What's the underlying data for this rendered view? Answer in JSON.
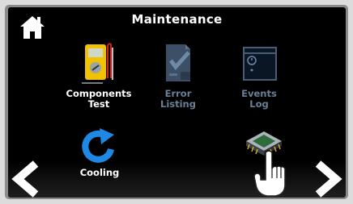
{
  "header": {
    "title": "Maintenance"
  },
  "tiles": [
    {
      "line1": "Components",
      "line2": "Test"
    },
    {
      "line1": "Error",
      "line2": "Listing"
    },
    {
      "line1": "Events",
      "line2": "Log"
    },
    {
      "line1": "Cooling"
    }
  ],
  "icons": {
    "home": "home-icon",
    "components": "multimeter-icon",
    "error": "error-listing-icon",
    "events": "events-log-icon",
    "cooling": "refresh-icon",
    "chip": "chip-icon",
    "left": "chevron-left-icon",
    "right": "chevron-right-icon",
    "hand": "pointing-hand-icon"
  },
  "colors": {
    "background": "#000000",
    "accent": "#1e88e5",
    "dim_label": "#6b7f96"
  }
}
